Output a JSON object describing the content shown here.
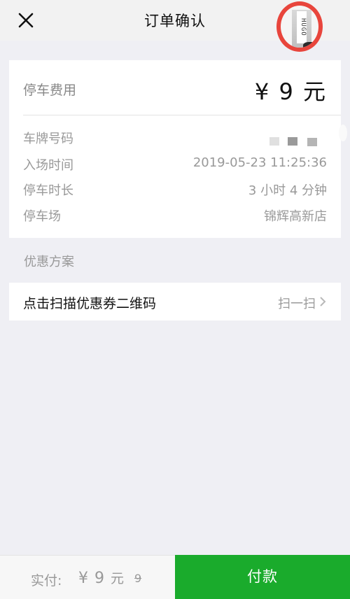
{
  "header": {
    "title": "订单确认",
    "close_icon": "close-icon",
    "avatar_logo_text": "HUGO"
  },
  "fee": {
    "label": "停车费用",
    "amount": "¥ 9 元"
  },
  "details": {
    "plate_label": "车牌号码",
    "entry_time_label": "入场时间",
    "entry_time_value": "2019-05-23 11:25:36",
    "duration_label": "停车时长",
    "duration_value": "3 小时 4 分钟",
    "lot_label": "停车场",
    "lot_value": "锦辉高新店"
  },
  "discount": {
    "section_title": "优惠方案",
    "scan_label": "点击扫描优惠券二维码",
    "scan_action": "扫一扫",
    "chevron_icon": "chevron-right-icon"
  },
  "footer": {
    "paid_label": "实付:",
    "paid_currency": "¥",
    "paid_value": "9",
    "paid_unit": "元",
    "original_price": "9",
    "pay_button": "付款"
  },
  "colors": {
    "accent_green": "#1aab2c",
    "avatar_ring": "#e8453c",
    "background": "#efeff4"
  }
}
